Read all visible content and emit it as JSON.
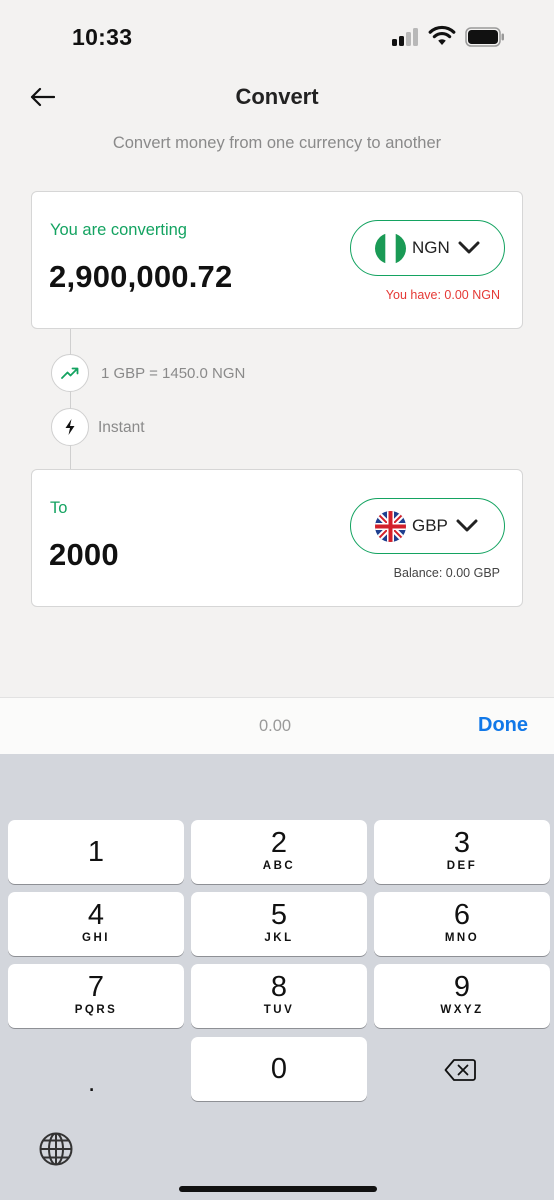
{
  "status_bar": {
    "time": "10:33",
    "signal_icon": "cellular-signal-icon",
    "wifi_icon": "wifi-icon",
    "battery_icon": "battery-icon"
  },
  "header": {
    "back_icon": "arrow-left-icon",
    "title": "Convert",
    "subtitle": "Convert money from one currency to another"
  },
  "from_card": {
    "label": "You are converting",
    "amount": "2,900,000.72",
    "currency": {
      "code": "NGN",
      "flag_icon": "nigeria-flag-icon"
    },
    "note": "You have: 0.00 NGN"
  },
  "rate": {
    "icon": "trending-up-icon",
    "text": "1 GBP = 1450.0 NGN"
  },
  "speed": {
    "icon": "lightning-icon",
    "text": "Instant"
  },
  "to_card": {
    "label": "To",
    "amount": "2000",
    "currency": {
      "code": "GBP",
      "flag_icon": "uk-flag-icon"
    },
    "note": "Balance: 0.00 GBP"
  },
  "toolbar": {
    "value": "0.00",
    "done_label": "Done"
  },
  "keyboard": {
    "keys": [
      {
        "num": "1",
        "letters": ""
      },
      {
        "num": "2",
        "letters": "ABC"
      },
      {
        "num": "3",
        "letters": "DEF"
      },
      {
        "num": "4",
        "letters": "GHI"
      },
      {
        "num": "5",
        "letters": "JKL"
      },
      {
        "num": "6",
        "letters": "MNO"
      },
      {
        "num": "7",
        "letters": "PQRS"
      },
      {
        "num": "8",
        "letters": "TUV"
      },
      {
        "num": "9",
        "letters": "WXYZ"
      },
      {
        "num": "0",
        "letters": ""
      }
    ],
    "decimal": ".",
    "backspace_icon": "backspace-icon",
    "globe_icon": "globe-icon"
  },
  "colors": {
    "accent_green": "#14a361",
    "warning_red": "#e53935",
    "done_blue": "#1178e8",
    "background": "#f3f2f1",
    "keyboard_bg": "#d3d6dc"
  }
}
